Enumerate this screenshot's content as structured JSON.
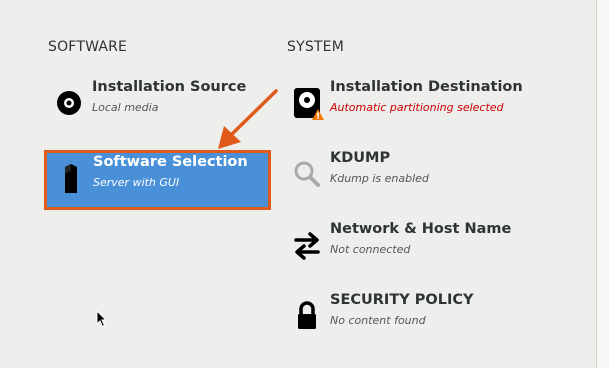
{
  "sections": {
    "software": "SOFTWARE",
    "system": "SYSTEM"
  },
  "spokes": {
    "installation_source": {
      "title": "Installation Source",
      "status": "Local media",
      "icon": "disc-icon"
    },
    "software_selection": {
      "title": "Software Selection",
      "status": "Server with GUI",
      "icon": "package-icon"
    },
    "installation_destination": {
      "title": "Installation Destination",
      "status": "Automatic partitioning selected",
      "icon": "harddisk-warning-icon"
    },
    "kdump": {
      "title": "KDUMP",
      "status": "Kdump is enabled",
      "icon": "search-icon"
    },
    "network": {
      "title": "Network & Host Name",
      "status": "Not connected",
      "icon": "network-arrows-icon"
    },
    "security": {
      "title": "SECURITY POLICY",
      "status": "No content found",
      "icon": "lock-icon"
    }
  },
  "colors": {
    "selected_bg": "#4a90d9",
    "highlight_border": "#e05a1c",
    "warning_text": "#cc0000"
  }
}
